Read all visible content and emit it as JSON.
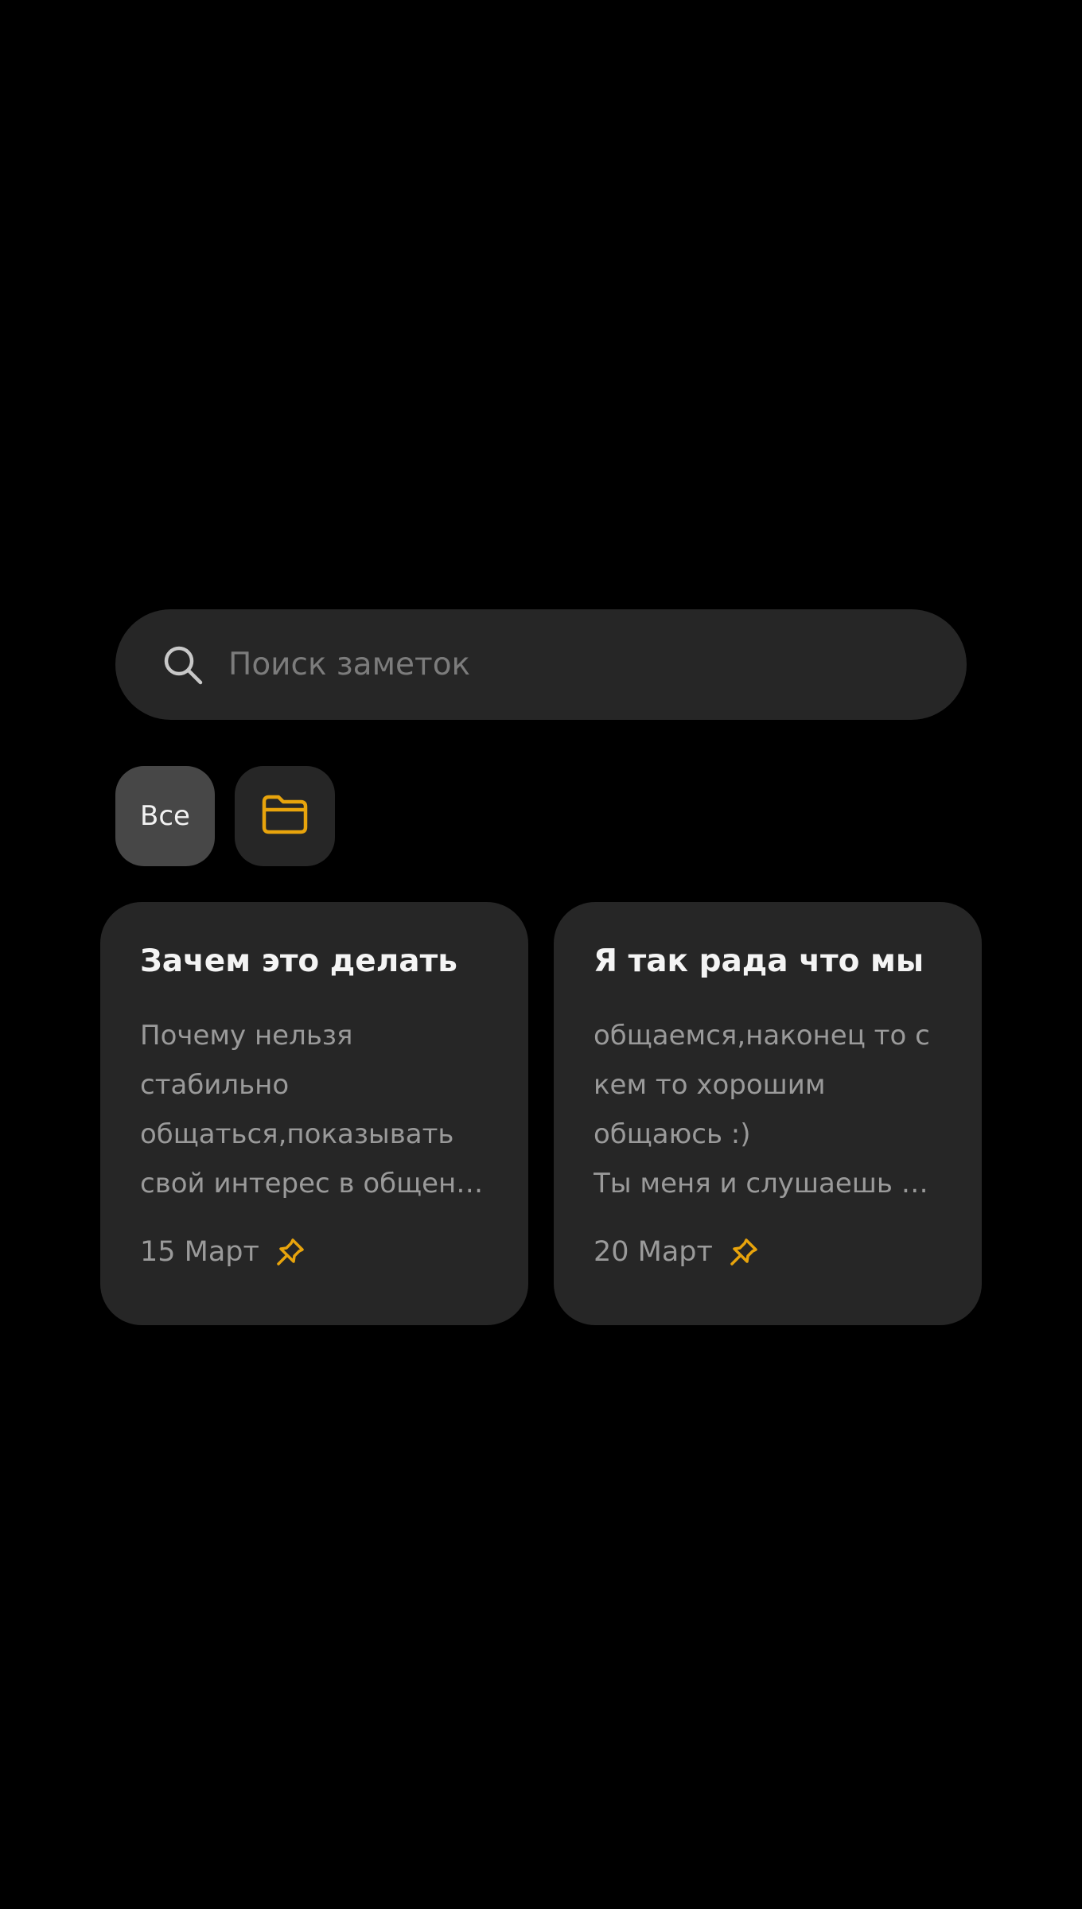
{
  "colors": {
    "background": "#000000",
    "surface": "#262626",
    "chip_selected": "#474747",
    "accent": "#E8A40C",
    "text_primary": "#F4F4F4",
    "text_secondary": "#9A9A9A",
    "placeholder": "#7C7C7C"
  },
  "search": {
    "icon": "search-icon",
    "placeholder": "Поиск заметок",
    "value": ""
  },
  "filters": {
    "all_label": "Все",
    "folder_icon": "folder-icon"
  },
  "notes": [
    {
      "title": "Зачем это делать",
      "lines": [
        "Почему нельзя",
        "стабильно",
        "общаться,показывать",
        "свой интерес в общени…"
      ],
      "date": "15 Март",
      "pinned": true,
      "pin_icon": "pin-icon"
    },
    {
      "title": "Я так рада что мы",
      "lines": [
        "общаемся,наконец то с",
        "кем то хорошим",
        "общаюсь :)",
        "Ты меня и слушаешь и …"
      ],
      "date": "20 Март",
      "pinned": true,
      "pin_icon": "pin-icon"
    }
  ]
}
